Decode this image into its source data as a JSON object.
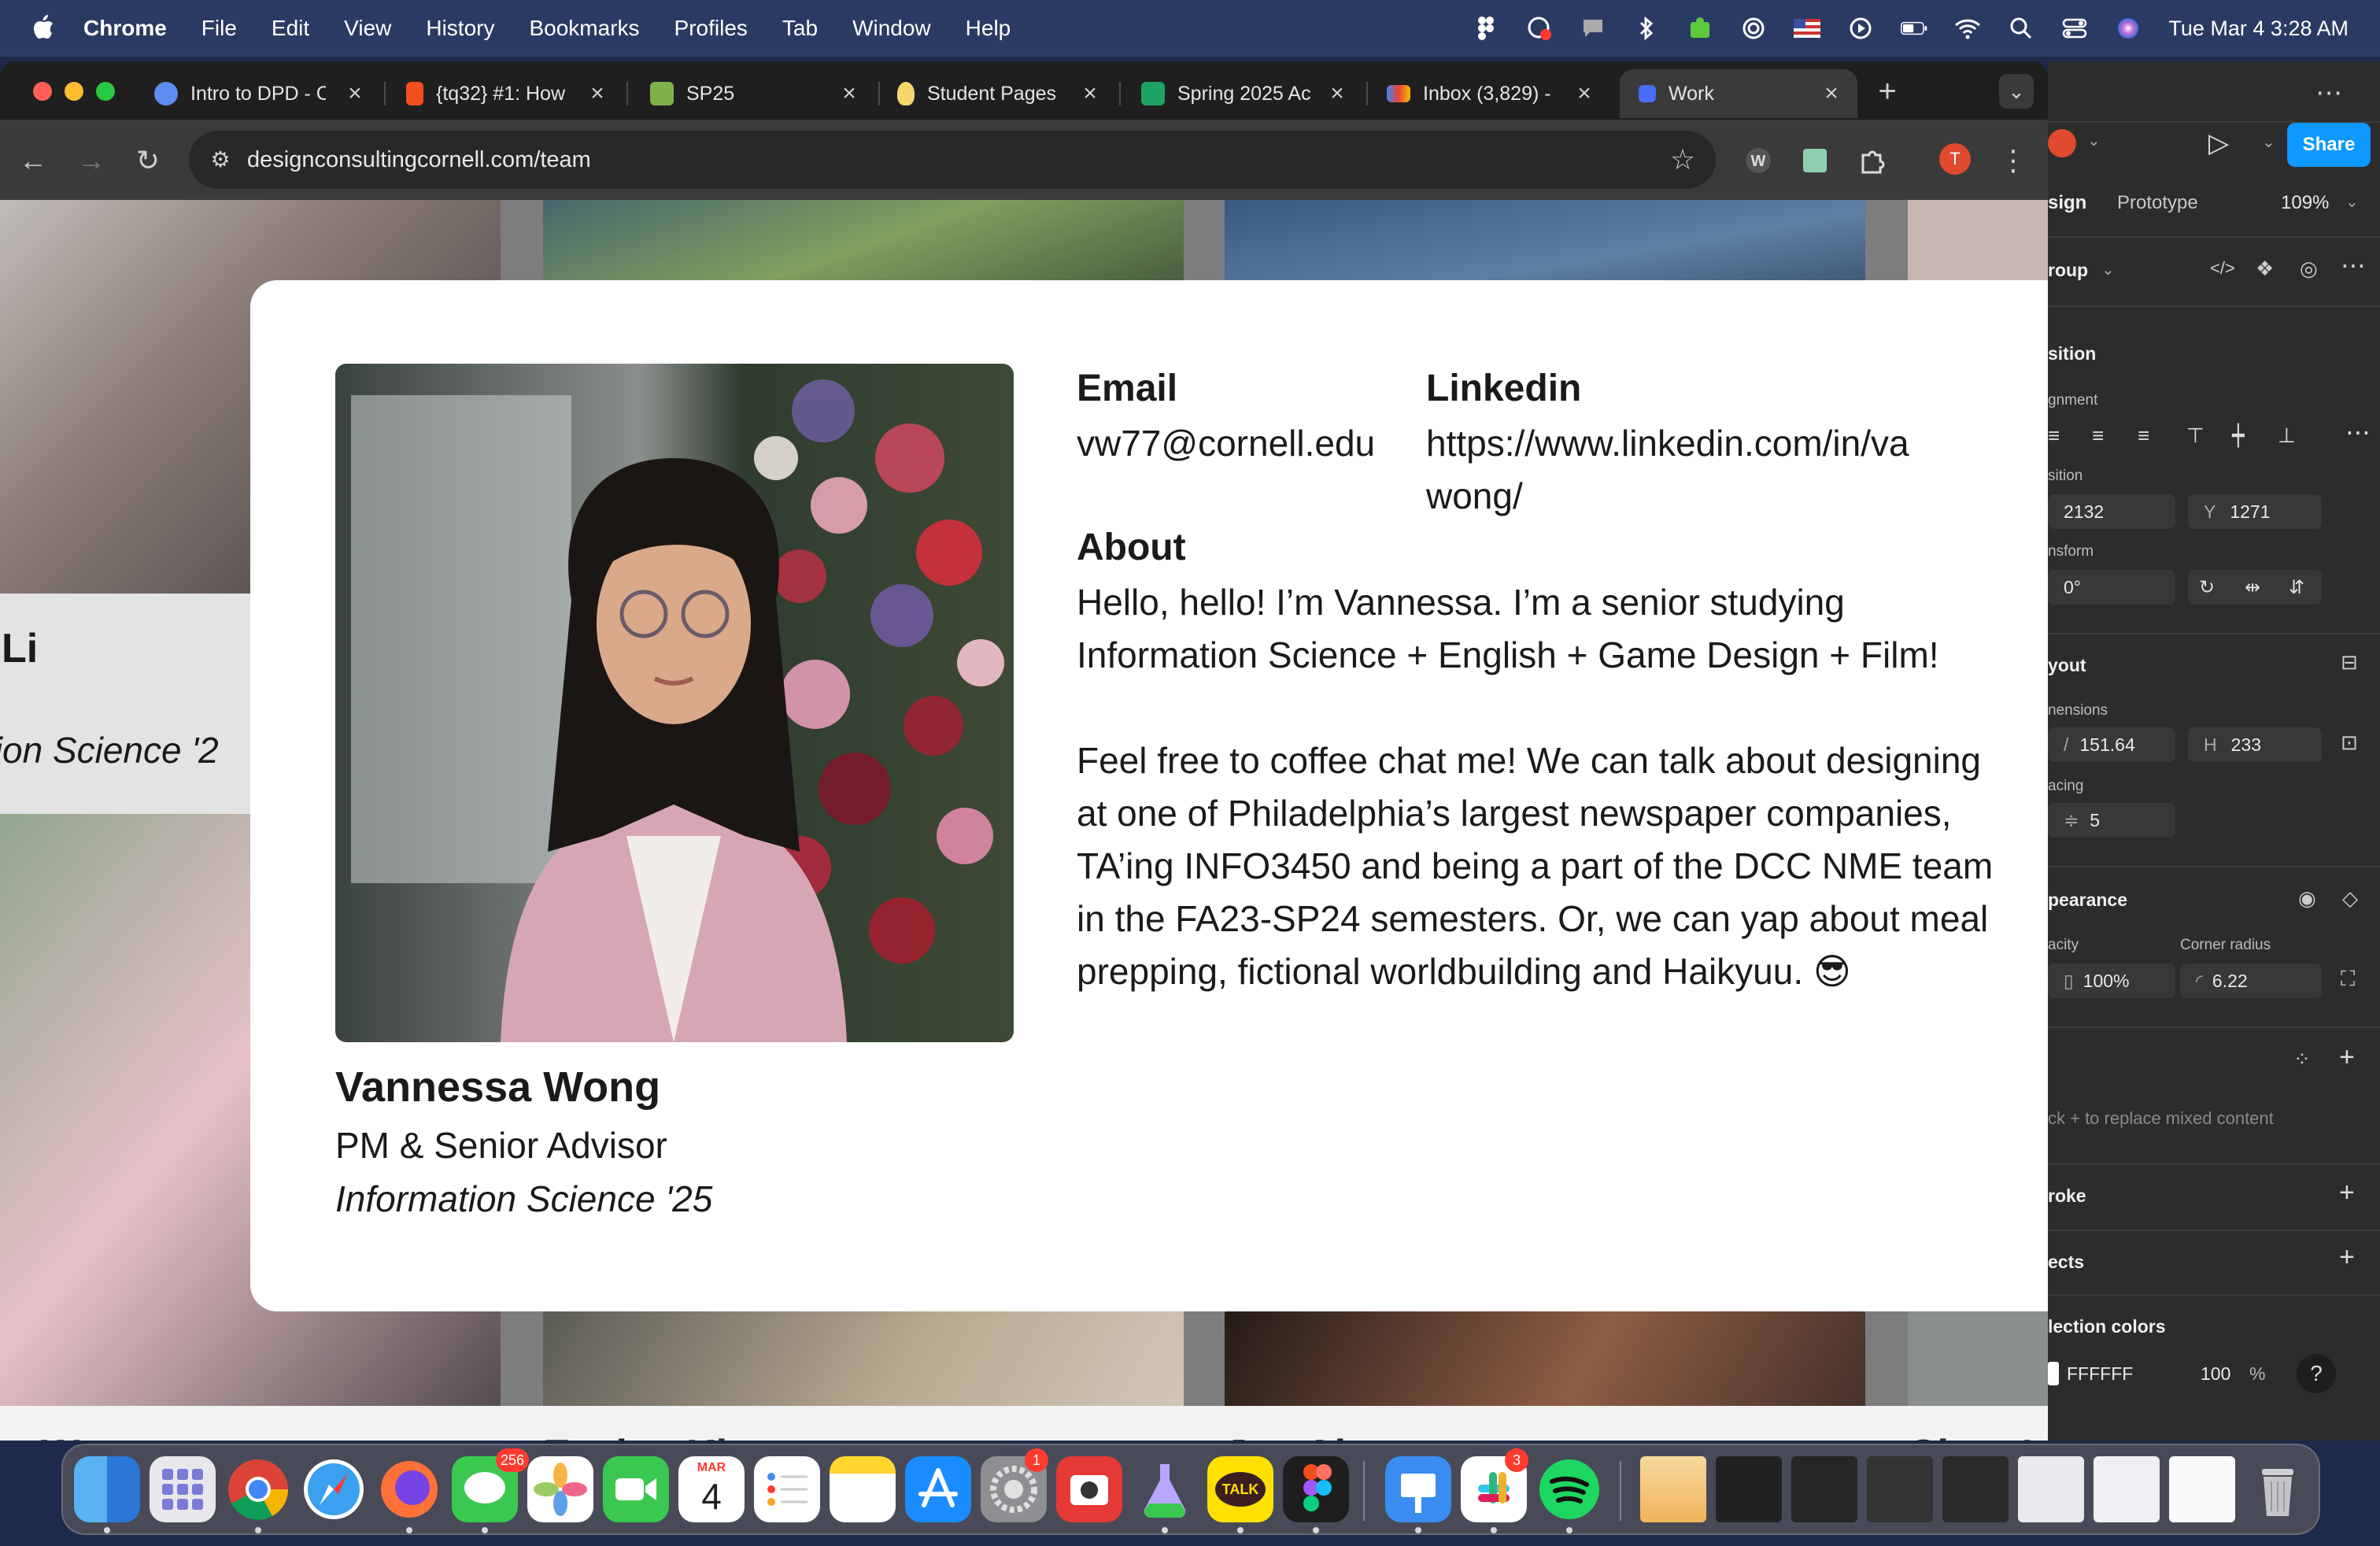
{
  "menubar": {
    "app": "Chrome",
    "items": [
      "File",
      "Edit",
      "View",
      "History",
      "Bookmarks",
      "Profiles",
      "Tab",
      "Window",
      "Help"
    ],
    "clock": "Tue Mar 4  3:28 AM"
  },
  "tabs": [
    {
      "title": "Intro to DPD - C",
      "favicon_color": "#5b8def"
    },
    {
      "title": "{tq32} #1: How",
      "favicon_color": "#f24e1e"
    },
    {
      "title": "SP25",
      "favicon_color": "#7fb04a"
    },
    {
      "title": "Student Pages",
      "favicon_color": "#f5d76e"
    },
    {
      "title": "Spring 2025 Ac",
      "favicon_color": "#1ea362"
    },
    {
      "title": "Inbox (3,829) -",
      "favicon_color": "#ea4335"
    },
    {
      "title": "Work",
      "favicon_color": "#4a6cf7",
      "active": true
    }
  ],
  "address_bar": {
    "url": "designconsultingcornell.com/team"
  },
  "profile_initial": "T",
  "background_page": {
    "name_fragment_left": "Li",
    "major_fragment_left": "tion Science '2",
    "bottom_names": [
      "sa Wong",
      "Evelyn Kim",
      "Joy Alemu",
      "Clara L"
    ]
  },
  "modal": {
    "email_label": "Email",
    "email_value": "vw77@cornell.edu",
    "linkedin_label": "Linkedin",
    "linkedin_line1": "https://www.linkedin.com/in/va",
    "linkedin_line2": "wong/",
    "about_label": "About",
    "about_p1_line1": "Hello, hello! I’m Vannessa. I’m a senior studying",
    "about_p1_line2": "Information Science + English + Game Design + Film!",
    "about_p2_lines": [
      "Feel free to coffee chat me! We can talk about designing",
      "at one of Philadelphia’s largest newspaper companies,",
      "TA’ing INFO3450 and being a part of the DCC NME team",
      "in the FA23-SP24 semesters. Or, we can yap about meal",
      "prepping, fictional worldbuilding and Haikyuu. 😎"
    ],
    "name": "Vannessa Wong",
    "role": "PM & Senior Advisor",
    "major": "Information Science '25"
  },
  "figma": {
    "share_label": "Share",
    "tab_design": "sign",
    "tab_prototype": "Prototype",
    "zoom": "109%",
    "layer_type": "roup",
    "position_label": "sition",
    "alignment_label": "gnment",
    "position_sub": "sition",
    "x_value": "2132",
    "y_label": "Y",
    "y_value": "1271",
    "transform_label": "nsform",
    "rotation": "0°",
    "layout_label": "yout",
    "dimensions_label": "nensions",
    "w_value": "151.64",
    "h_label": "H",
    "h_value": "233",
    "spacing_label": "acing",
    "spacing_value": "5",
    "appearance_label": "pearance",
    "opacity_label": "acity",
    "opacity_value": "100%",
    "corner_label": "Corner radius",
    "corner_value": "6.22",
    "fill_hint": "ck + to replace mixed content",
    "stroke_label": "roke",
    "effects_label": "ects",
    "selection_colors_label": "lection colors",
    "color_hex": "FFFFFF",
    "color_opacity": "100",
    "percent": "%",
    "help": "?"
  },
  "dock": {
    "messages_badge": "256",
    "calendar_month": "MAR",
    "calendar_day": "4",
    "settings_badge": "1",
    "slack_badge": "3",
    "kakao_label": "TALK"
  }
}
